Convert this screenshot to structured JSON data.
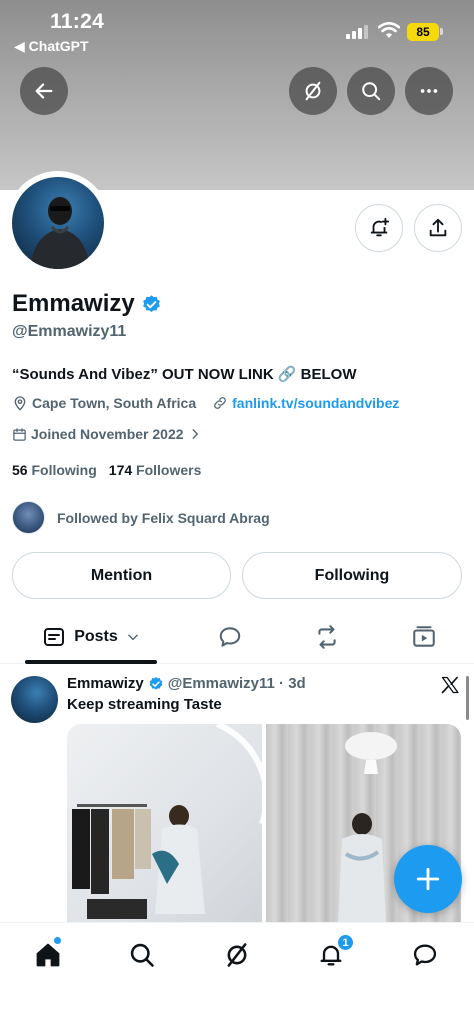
{
  "status_bar": {
    "time": "11:24",
    "back_app": "◀ ChatGPT",
    "battery": "85"
  },
  "profile": {
    "display_name": "Emmawizy",
    "handle": "@Emmawizy11",
    "bio": "“Sounds And Vibez” OUT NOW LINK 🔗 BELOW",
    "location": "Cape Town, South Africa",
    "website": "fanlink.tv/soundandvibez",
    "joined": "Joined November 2022",
    "following_count": "56",
    "following_label": "Following",
    "followers_count": "174",
    "followers_label": "Followers",
    "followed_by": "Followed by Felix Squard Abrag"
  },
  "actions": {
    "mention": "Mention",
    "following": "Following"
  },
  "tabs": {
    "posts": "Posts"
  },
  "post": {
    "name": "Emmawizy",
    "handle_time": "@Emmawizy11 · 3d",
    "text": "Keep streaming Taste"
  },
  "nav": {
    "notification_badge": "1"
  },
  "colors": {
    "accent": "#1d9bf0",
    "text": "#0f1419",
    "secondary": "#536471",
    "border": "#cfd9de",
    "battery": "#f5d90a"
  },
  "icons": [
    "back-arrow-icon",
    "grok-icon",
    "search-icon",
    "more-icon",
    "notification-add-icon",
    "share-icon",
    "verified-badge-icon",
    "location-icon",
    "link-icon",
    "calendar-icon",
    "chevron-right-icon",
    "chevron-down-icon",
    "x-logo-icon",
    "plus-icon",
    "home-icon",
    "bell-icon",
    "messages-icon"
  ]
}
